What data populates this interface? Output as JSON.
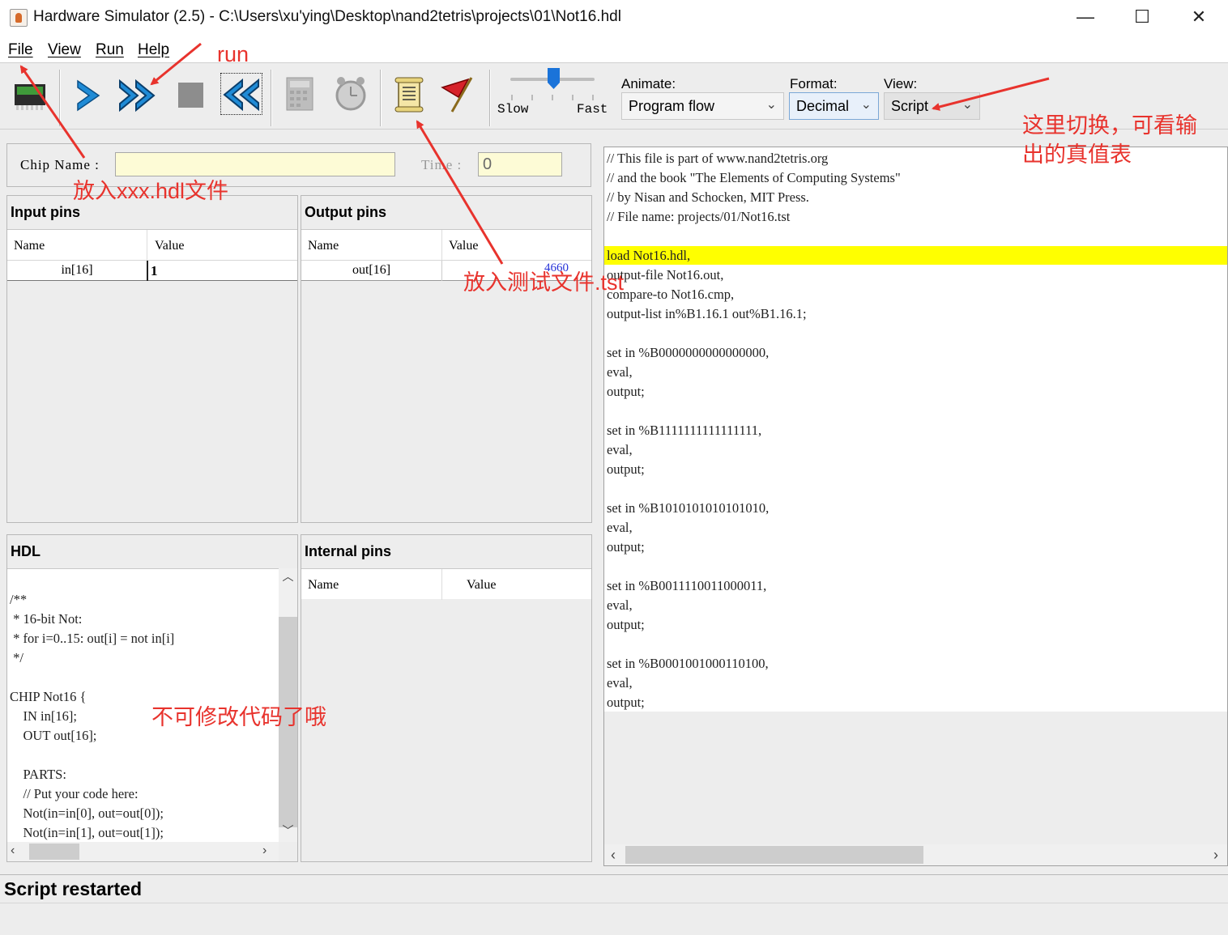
{
  "window": {
    "title": "Hardware Simulator (2.5) - C:\\Users\\xu'ying\\Desktop\\nand2tetris\\projects\\01\\Not16.hdl",
    "minimize": "—",
    "maximize": "☐",
    "close": "✕"
  },
  "menu": {
    "file": "File",
    "view": "View",
    "run": "Run",
    "help": "Help"
  },
  "toolbar": {
    "speed_slow": "Slow",
    "speed_fast": "Fast",
    "animate_label": "Animate:",
    "animate_value": "Program flow",
    "format_label": "Format:",
    "format_value": "Decimal",
    "view_label": "View:",
    "view_value": "Script"
  },
  "chip": {
    "name_label": "Chip Name :",
    "name_value": "",
    "time_label": "Time :",
    "time_value": "0"
  },
  "input_pins": {
    "title": "Input pins",
    "col_name": "Name",
    "col_value": "Value",
    "rows": [
      {
        "name": "in[16]",
        "value": "1"
      }
    ]
  },
  "output_pins": {
    "title": "Output pins",
    "col_name": "Name",
    "col_value": "Value",
    "rows": [
      {
        "name": "out[16]",
        "value": "4660"
      }
    ]
  },
  "hdl": {
    "title": "HDL",
    "lines": [
      "/**",
      " * 16-bit Not:",
      " * for i=0..15: out[i] = not in[i]",
      " */",
      "",
      "CHIP Not16 {",
      "    IN in[16];",
      "    OUT out[16];",
      "",
      "    PARTS:",
      "    // Put your code here:",
      "    Not(in=in[0], out=out[0]);",
      "    Not(in=in[1], out=out[1]);"
    ]
  },
  "internal_pins": {
    "title": "Internal pins",
    "col_name": "Name",
    "col_value": "Value"
  },
  "script": {
    "lines": [
      "// This file is part of www.nand2tetris.org",
      "// and the book \"The Elements of Computing Systems\"",
      "// by Nisan and Schocken, MIT Press.",
      "// File name: projects/01/Not16.tst",
      "",
      "load Not16.hdl,",
      "output-file Not16.out,",
      "compare-to Not16.cmp,",
      "output-list in%B1.16.1 out%B1.16.1;",
      "",
      "set in %B0000000000000000,",
      "eval,",
      "output;",
      "",
      "set in %B1111111111111111,",
      "eval,",
      "output;",
      "",
      "set in %B1010101010101010,",
      "eval,",
      "output;",
      "",
      "set in %B0011110011000011,",
      "eval,",
      "output;",
      "",
      "set in %B0001001000110100,",
      "eval,",
      "output;"
    ],
    "highlighted_line": 5,
    "highlight_color": "#ffff00"
  },
  "status": {
    "message": "Script restarted"
  },
  "annotations": {
    "run": "run",
    "load_hdl": "放入xxx.hdl文件",
    "load_test": "放入测试文件.tst",
    "switch_view": "这里切换，可看输",
    "switch_view_2": "出的真值表",
    "no_edit": "不可修改代码了哦",
    "color": "#e8332d"
  }
}
